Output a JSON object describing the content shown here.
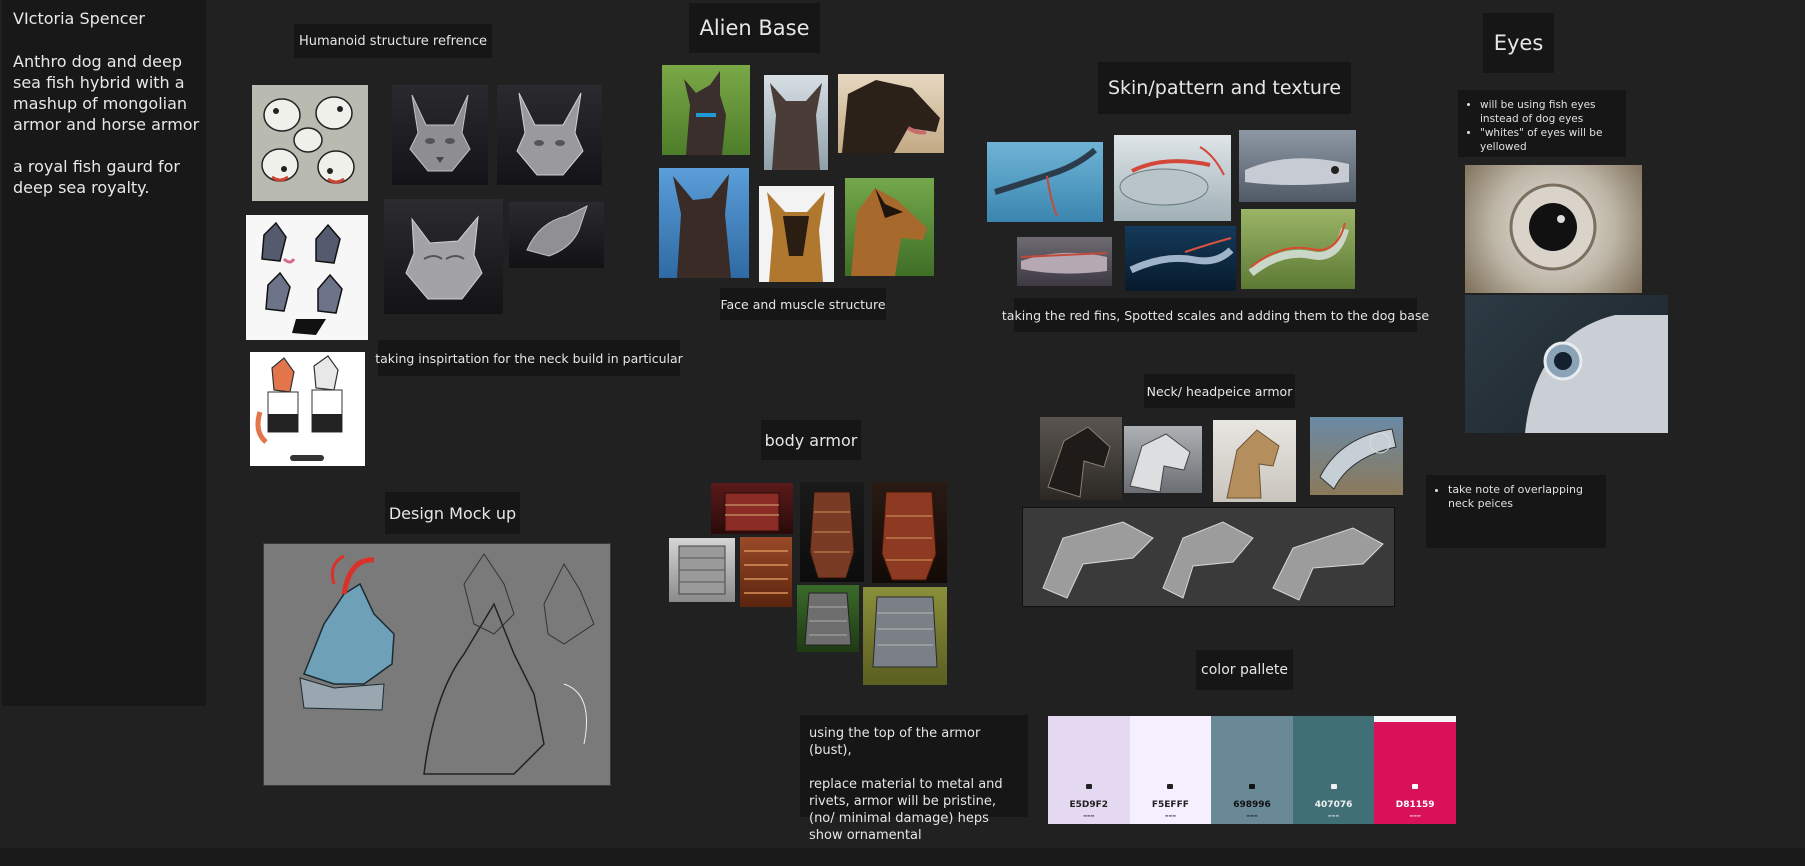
{
  "sidebar": {
    "author": "VIctoria Spencer",
    "description": "Anthro dog and deep sea fish hybrid with a mashup of mongolian armor and horse armor\n\na royal fish gaurd for deep sea royalty."
  },
  "labels": {
    "humanoid": "Humanoid structure refrence",
    "alien_base": "Alien Base",
    "skin": "Skin/pattern and texture",
    "eyes": "Eyes",
    "face_muscle": "Face and muscle structure",
    "red_fins": "taking the red fins, Spotted scales and adding them to the dog base",
    "neck_inspo": "taking inspirtation for the neck build in particular",
    "neck_armor": "Neck/ headpeice armor",
    "body_armor": "body armor",
    "design_mockup": "Design Mock up",
    "color_palette": "color pallete"
  },
  "notes": {
    "eyes_bullets": [
      "will be using fish eyes instead of dog eyes",
      "\"whites\" of eyes will be yellowed"
    ],
    "neck_bullets": [
      "take note of overlapping neck peices"
    ],
    "armor_note": "using the top of the armor (bust),\n\nreplace material to metal and rivets, armor will be pristine, (no/ minimal damage) heps show ornamental"
  },
  "palette": [
    {
      "hex": "E5D9F2",
      "color": "#E5D9F2",
      "text_color": "#222222"
    },
    {
      "hex": "F5EFFF",
      "color": "#F5EFFF",
      "text_color": "#222222"
    },
    {
      "hex": "698996",
      "color": "#698996",
      "text_color": "#111111"
    },
    {
      "hex": "407076",
      "color": "#407076",
      "text_color": "#f0f0f0"
    },
    {
      "hex": "D81159",
      "color": "#D81159",
      "text_color": "#ffffff"
    }
  ],
  "colors": {
    "board": "#212121",
    "sidebar": "#181818",
    "label_bg": "#161616",
    "text": "#e6e6e6"
  }
}
